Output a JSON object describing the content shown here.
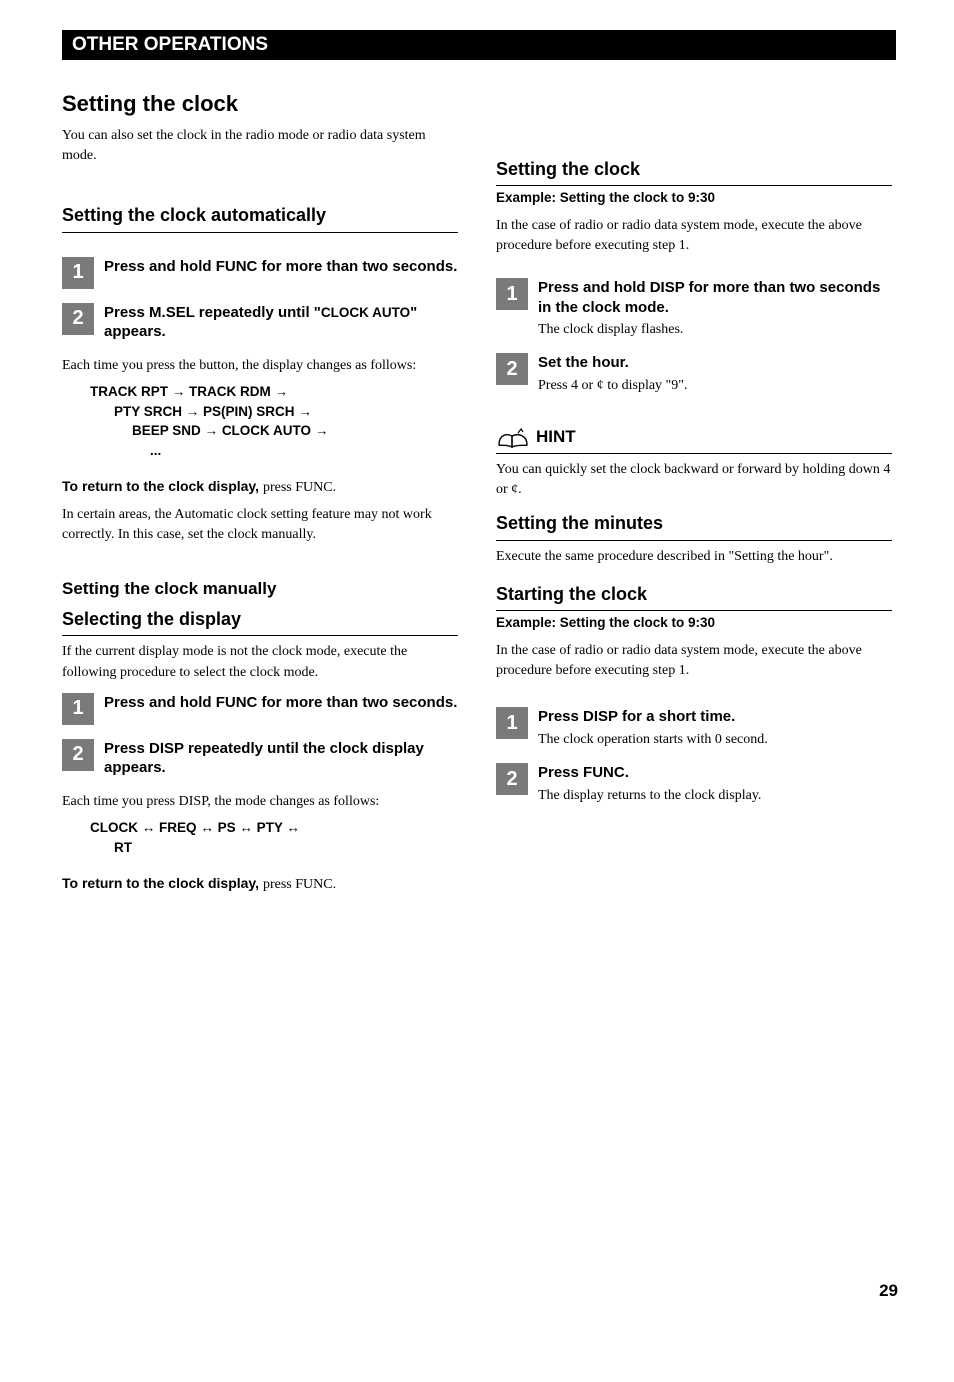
{
  "topbar": "OTHER OPERATIONS",
  "left": {
    "sec1_title": "Setting the clock",
    "sec1_intro": "You can also set the clock in the radio mode or radio data system mode.",
    "sub1": "Setting the clock automatically",
    "step1": "Press and hold FUNC for more than two seconds.",
    "step2_a": "Press M.SEL repeatedly until \"",
    "step2_b_sans": "CLOCK AUTO",
    "step2_c": "\" appears.",
    "each_press": "Each time you press the button, the display changes as follows:",
    "cycle1": {
      "a": "TRACK RPT",
      "b": "TRACK RDM",
      "c": "PTY SRCH",
      "d": "PS(PIN) SRCH",
      "e": "BEEP SND",
      "f": "CLOCK AUTO"
    },
    "return1": "To return to the clock display, ",
    "return1b": "press FUNC.",
    "note1": "In certain areas, the Automatic clock setting feature may not work correctly. In this case, set the clock manually.",
    "sec2_title": "Setting the clock manually",
    "sub2": "Selecting the display",
    "sub2_intro": "If the current display mode is not the clock mode, execute the following procedure to select the clock mode.",
    "step3": "Press and hold FUNC for more than two seconds.",
    "step4": "Press DISP repeatedly until the clock display appears.",
    "each_press2": "Each time you press DISP, the mode changes as follows:",
    "cycle2": {
      "a": "CLOCK",
      "b": "FREQ",
      "c": "PS",
      "d": "PTY",
      "e": "RT"
    },
    "return2": "To return to the clock display, ",
    "return2b": "press FUNC."
  },
  "right": {
    "sub1": "Setting the clock",
    "step_intro1": "Example: Setting the clock to 9:30",
    "intro_body": "In the case of radio or radio data system mode, execute the above procedure before executing step 1.",
    "step1_a": "Press and hold DISP for more than two seconds in the clock mode.",
    "step1_b": "The clock display flashes.",
    "step2_a": "Set the hour.",
    "step2_b": "Press 4 or ¢ to display \"9\".",
    "hint_label": "HINT",
    "hint_body": "You can quickly set the clock backward or forward by holding down 4 or ¢.",
    "sub2": "Setting the minutes",
    "sub2_body": "Execute the same procedure described in \"Setting the hour\".",
    "sub3": "Starting the clock",
    "step1b_a": "Press DISP for a short time.",
    "step1b_b": "The clock operation starts with 0 second.",
    "step2b_a": "Press FUNC.",
    "step2b_b": "The display returns to the clock display."
  },
  "pagenum": "29"
}
